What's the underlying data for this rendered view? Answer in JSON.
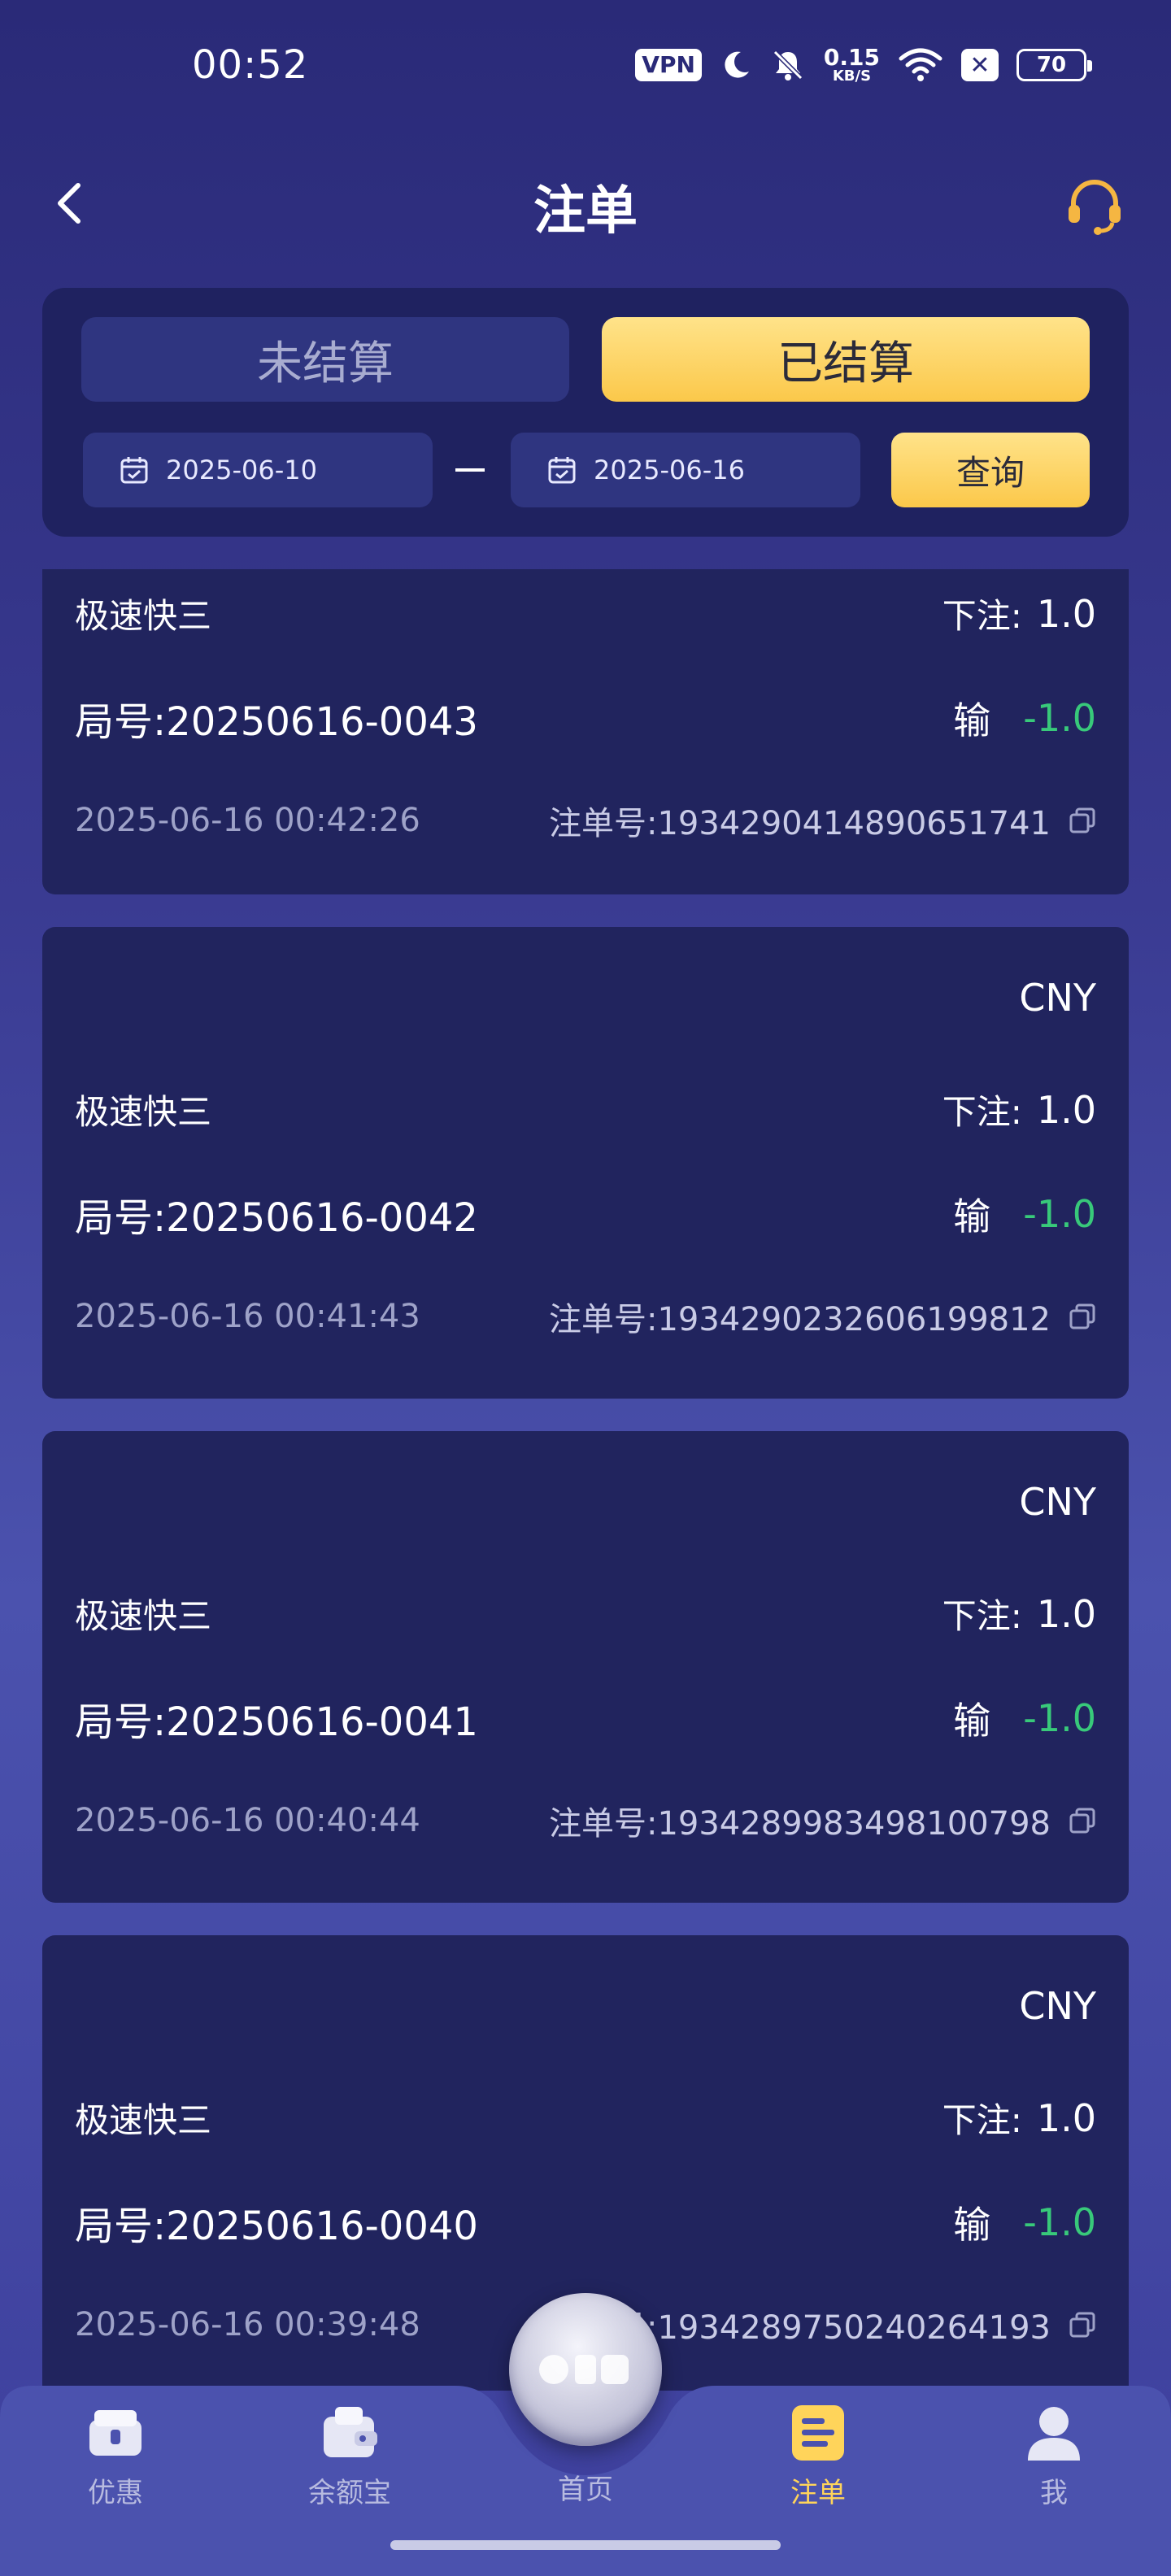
{
  "status_bar": {
    "time": "00:52",
    "vpn": "VPN",
    "net_speed_value": "0.15",
    "net_speed_unit": "KB/S",
    "battery": "70",
    "icons": [
      "vpn-badge",
      "moon-icon",
      "bell-off-icon",
      "wifi-icon",
      "close-box-icon",
      "battery-icon"
    ]
  },
  "header": {
    "title": "注单",
    "back_icon": "chevron-left-icon",
    "support_icon": "headset-icon"
  },
  "filter": {
    "tabs": [
      {
        "label": "未结算",
        "active": false
      },
      {
        "label": "已结算",
        "active": true
      }
    ],
    "start_date": "2025-06-10",
    "end_date": "2025-06-16",
    "query_label": "查询"
  },
  "records": [
    {
      "currency": "",
      "game": "极速快三",
      "bet_label": "下注:",
      "bet_amount": "1.0",
      "round": "局号:20250616-0043",
      "result_label": "输",
      "result_amount": "-1.0",
      "time": "2025-06-16 00:42:26",
      "order": "注单号:1934290414890651741"
    },
    {
      "currency": "CNY",
      "game": "极速快三",
      "bet_label": "下注:",
      "bet_amount": "1.0",
      "round": "局号:20250616-0042",
      "result_label": "输",
      "result_amount": "-1.0",
      "time": "2025-06-16 00:41:43",
      "order": "注单号:1934290232606199812"
    },
    {
      "currency": "CNY",
      "game": "极速快三",
      "bet_label": "下注:",
      "bet_amount": "1.0",
      "round": "局号:20250616-0041",
      "result_label": "输",
      "result_amount": "-1.0",
      "time": "2025-06-16 00:40:44",
      "order": "注单号:1934289983498100798"
    },
    {
      "currency": "CNY",
      "game": "极速快三",
      "bet_label": "下注:",
      "bet_amount": "1.0",
      "round": "局号:20250616-0040",
      "result_label": "输",
      "result_amount": "-1.0",
      "time": "2025-06-16 00:39:48",
      "order": "注单号:1934289750240264193"
    }
  ],
  "nav": {
    "items": [
      {
        "label": "优惠",
        "icon": "gift-icon",
        "active": false
      },
      {
        "label": "余额宝",
        "icon": "wallet-icon",
        "active": false
      },
      {
        "label": "首页",
        "icon": "home-logo-icon",
        "active": false
      },
      {
        "label": "注单",
        "icon": "bets-list-icon",
        "active": true
      },
      {
        "label": "我",
        "icon": "user-icon",
        "active": false
      }
    ]
  },
  "colors": {
    "accent": "#fbc84a",
    "loss": "#38c97a",
    "card_bg": "#21245e",
    "panel_bg": "#1f2260"
  }
}
